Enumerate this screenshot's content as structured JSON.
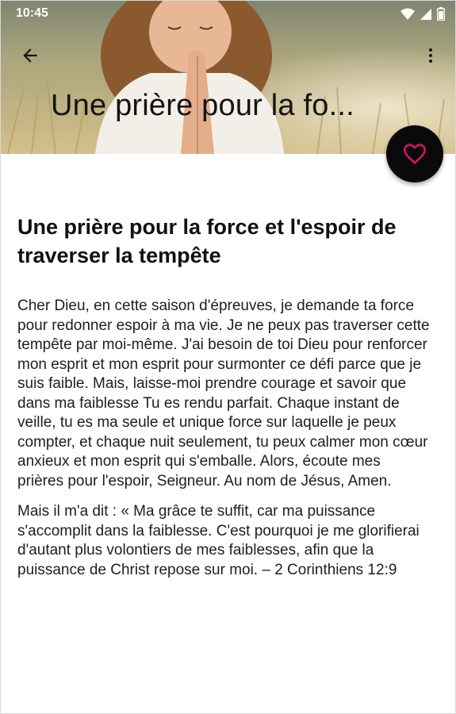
{
  "status_bar": {
    "time": "10:45",
    "icons": [
      "wifi-icon",
      "signal-icon",
      "battery-icon"
    ]
  },
  "app_bar": {
    "title": "Une prière pour la fo...",
    "back_icon": "arrow-back-icon",
    "menu_icon": "more-vert-icon"
  },
  "fab": {
    "icon": "heart-outline-icon",
    "icon_color": "#c2185b"
  },
  "article": {
    "title": "Une prière pour la force et l'espoir de traverser la tempête",
    "paragraphs": [
      "Cher Dieu, en cette saison d'épreuves, je demande ta force pour redonner espoir à ma vie. Je ne peux pas traverser cette tempête par moi-même. J'ai besoin de toi Dieu pour renforcer mon esprit et mon esprit pour surmonter ce défi parce que je suis faible. Mais, laisse-moi prendre courage et savoir que dans ma faiblesse Tu es rendu parfait. Chaque instant de veille, tu es ma seule et unique force sur laquelle je peux compter, et chaque nuit seulement, tu peux calmer mon cœur anxieux et mon esprit qui s'emballe. Alors, écoute mes prières pour l'espoir, Seigneur. Au nom de Jésus, Amen.",
      "Mais il m'a dit : « Ma grâce te suffit, car ma puissance s'accomplit dans la faiblesse. C'est pourquoi je me glorifierai d'autant plus volontiers de mes faiblesses, afin que la puissance de Christ repose sur moi. – 2 Corinthiens 12:9"
    ]
  },
  "colors": {
    "fab_background": "#0a0a0a",
    "heart": "#c2185b",
    "text": "#1e1e1e"
  }
}
